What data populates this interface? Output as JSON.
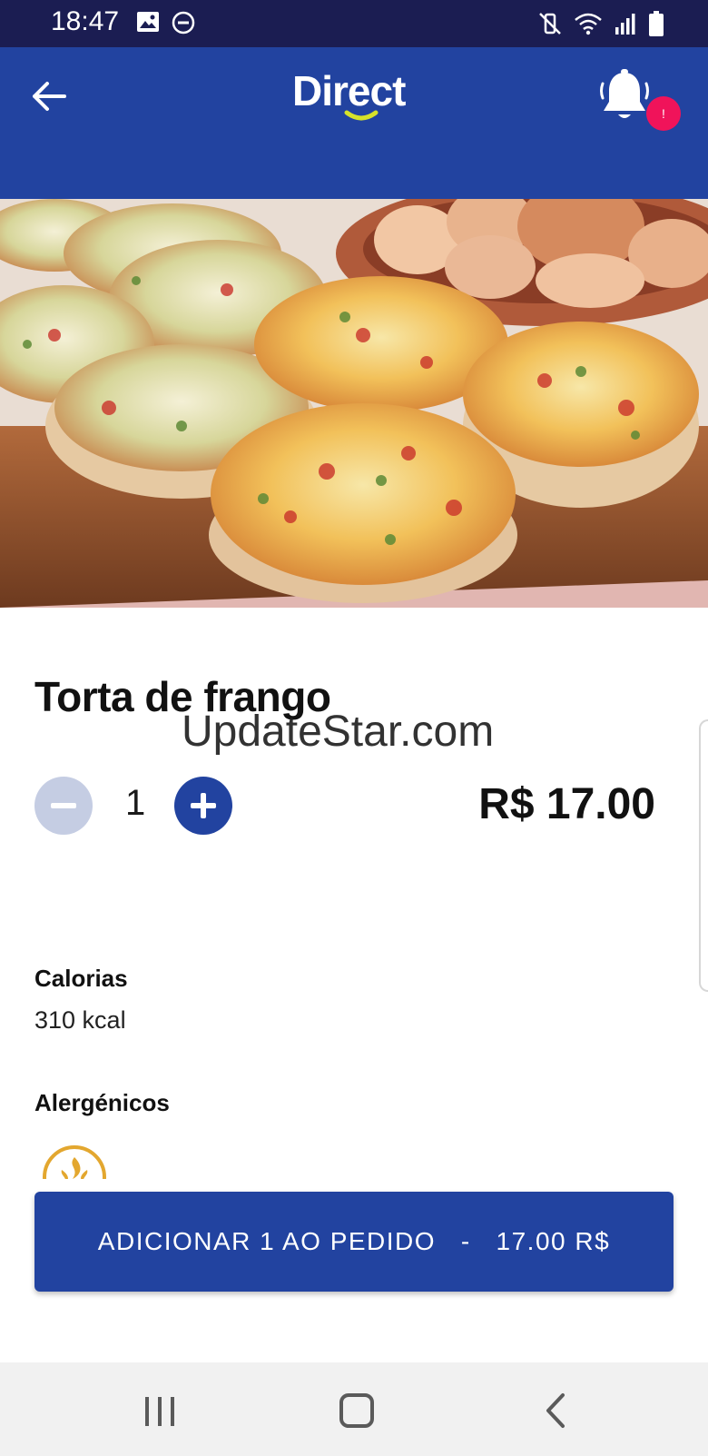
{
  "status_bar": {
    "time": "18:47",
    "left_icons": [
      "image-icon",
      "do-not-disturb-icon"
    ],
    "right_icons": [
      "mute-vibrate-icon",
      "wifi-icon",
      "signal-icon",
      "battery-icon"
    ]
  },
  "header": {
    "back_icon": "arrow-left-icon",
    "logo_text": "Direct",
    "notification_icon": "bell-icon",
    "notification_badge": "!",
    "colors": {
      "header_bg": "#2243a0",
      "badge": "#f0135a",
      "logo_smile": "#d6e22a"
    }
  },
  "hero": {
    "description_icon": "product-photo-quiches"
  },
  "product": {
    "title": "Torta de frango",
    "quantity": "1",
    "price": "R$ 17.00",
    "minus_icon": "minus-icon",
    "plus_icon": "plus-icon"
  },
  "watermark": "UpdateStar.com",
  "details": {
    "calories_label": "Calorias",
    "calories_value": "310 kcal",
    "allergens_label": "Alergénicos",
    "allergen_icons": [
      "gluten-icon"
    ]
  },
  "cta": {
    "label": "ADICIONAR 1 AO PEDIDO   -   17.00 R$",
    "color": "#2243a0"
  },
  "nav_bar": {
    "icons": [
      "recents-icon",
      "home-icon",
      "back-icon"
    ]
  }
}
